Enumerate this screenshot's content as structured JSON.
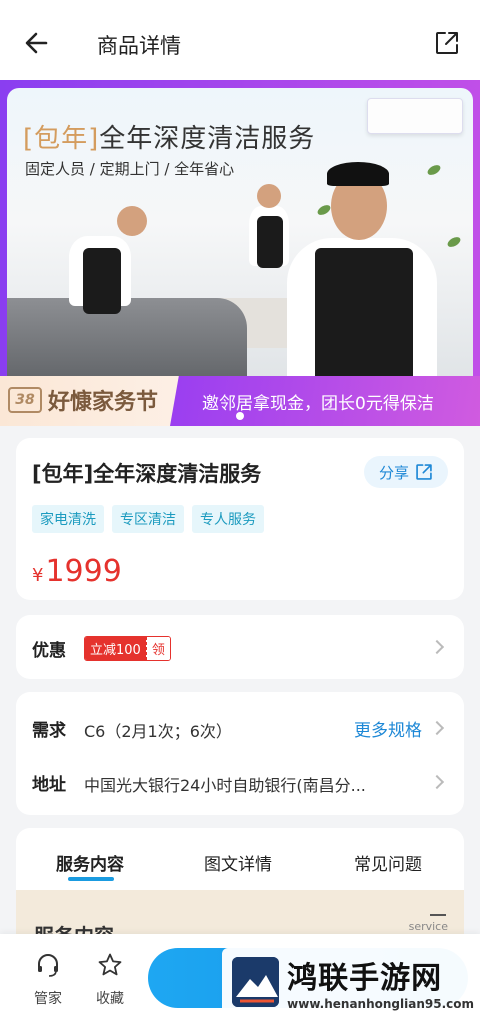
{
  "header": {
    "title": "商品详情",
    "icons": {
      "back": "arrow-left-icon",
      "share": "external-share-icon"
    }
  },
  "banner": {
    "title_bracket": "[包年]",
    "title_main": "全年深度清洁服务",
    "subtitle": "固定人员 / 定期上门 / 全年省心",
    "festival_badge": "38",
    "festival_text": "好慷家务节",
    "promo_text": "邀邻居拿现金，团长0元得保洁"
  },
  "product": {
    "name": "[包年]全年深度清洁服务",
    "share_label": "分享",
    "tags": [
      "家电清洗",
      "专区清洁",
      "专人服务"
    ],
    "currency": "¥",
    "price": "1999"
  },
  "discount": {
    "label": "优惠",
    "coupon_text": "立减100",
    "coupon_action": "领"
  },
  "specs": {
    "demand_label": "需求",
    "demand_value": "C6（2月1次；6次）",
    "more_label": "更多规格",
    "address_label": "地址",
    "address_value": "中国光大银行24小时自助银行(南昌分..."
  },
  "tabs": [
    {
      "label": "服务内容",
      "active": true
    },
    {
      "label": "图文详情",
      "active": false
    },
    {
      "label": "常见问题",
      "active": false
    }
  ],
  "service_section": {
    "title": "服务内容",
    "en_label": "service"
  },
  "bottom_bar": {
    "items": [
      {
        "label": "管家",
        "icon": "headset-icon"
      },
      {
        "label": "收藏",
        "icon": "star-icon"
      }
    ]
  },
  "watermark": {
    "title": "鸿联手游网",
    "url": "www.henanhonglian95.com"
  },
  "colors": {
    "accent_blue": "#1e88d6",
    "price_red": "#e5322d",
    "banner_purple": "#8a3ef0"
  }
}
